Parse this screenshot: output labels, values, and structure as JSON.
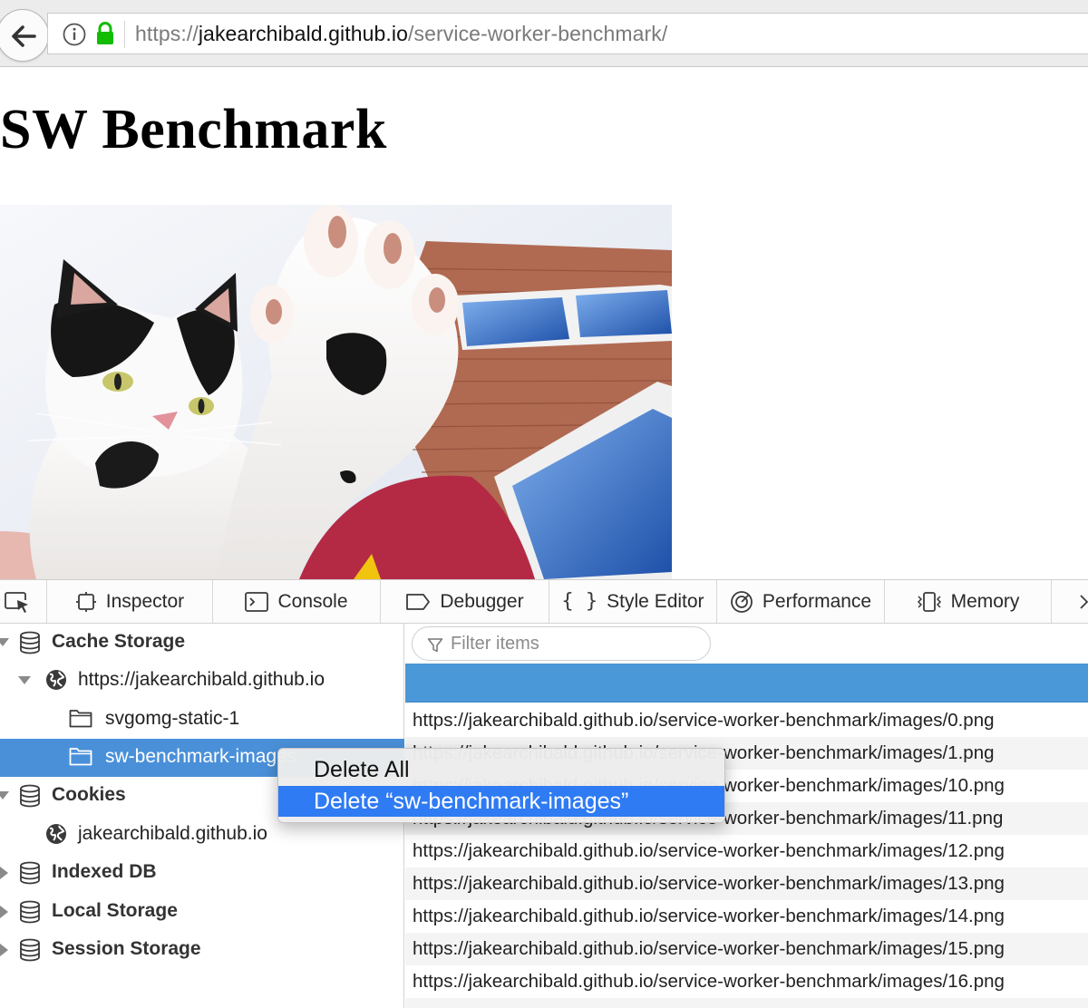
{
  "browser": {
    "url_prefix": "https://",
    "url_host": "jakearchibald.github.io",
    "url_path": "/service-worker-benchmark/"
  },
  "page": {
    "title": "SW Benchmark"
  },
  "devtools": {
    "tabs": [
      {
        "label": "Inspector",
        "icon": "inspector-icon"
      },
      {
        "label": "Console",
        "icon": "console-icon"
      },
      {
        "label": "Debugger",
        "icon": "debugger-icon"
      },
      {
        "label": "Style Editor",
        "icon": "style-editor-icon"
      },
      {
        "label": "Performance",
        "icon": "performance-icon"
      },
      {
        "label": "Memory",
        "icon": "memory-icon"
      }
    ],
    "tree": {
      "cache_storage": "Cache Storage",
      "cache_origin": "https://jakearchibald.github.io",
      "cache_svgomg": "svgomg-static-1",
      "cache_sw": "sw-benchmark-images",
      "cookies": "Cookies",
      "cookies_origin": "jakearchibald.github.io",
      "indexed_db": "Indexed DB",
      "local_storage": "Local Storage",
      "session_storage": "Session Storage"
    },
    "filter_placeholder": "Filter items",
    "rows": [
      "https://jakearchibald.github.io/service-worker-benchmark/images/0.png",
      "https://jakearchibald.github.io/service-worker-benchmark/images/1.png",
      "https://jakearchibald.github.io/service-worker-benchmark/images/10.png",
      "https://jakearchibald.github.io/service-worker-benchmark/images/11.png",
      "https://jakearchibald.github.io/service-worker-benchmark/images/12.png",
      "https://jakearchibald.github.io/service-worker-benchmark/images/13.png",
      "https://jakearchibald.github.io/service-worker-benchmark/images/14.png",
      "https://jakearchibald.github.io/service-worker-benchmark/images/15.png",
      "https://jakearchibald.github.io/service-worker-benchmark/images/16.png"
    ]
  },
  "context_menu": {
    "delete_all": "Delete All",
    "delete_cache": "Delete “sw-benchmark-images”"
  },
  "colors": {
    "selection": "#4a90d9",
    "header_blue": "#4a98d8",
    "menu_highlight": "#2f7bf3"
  }
}
